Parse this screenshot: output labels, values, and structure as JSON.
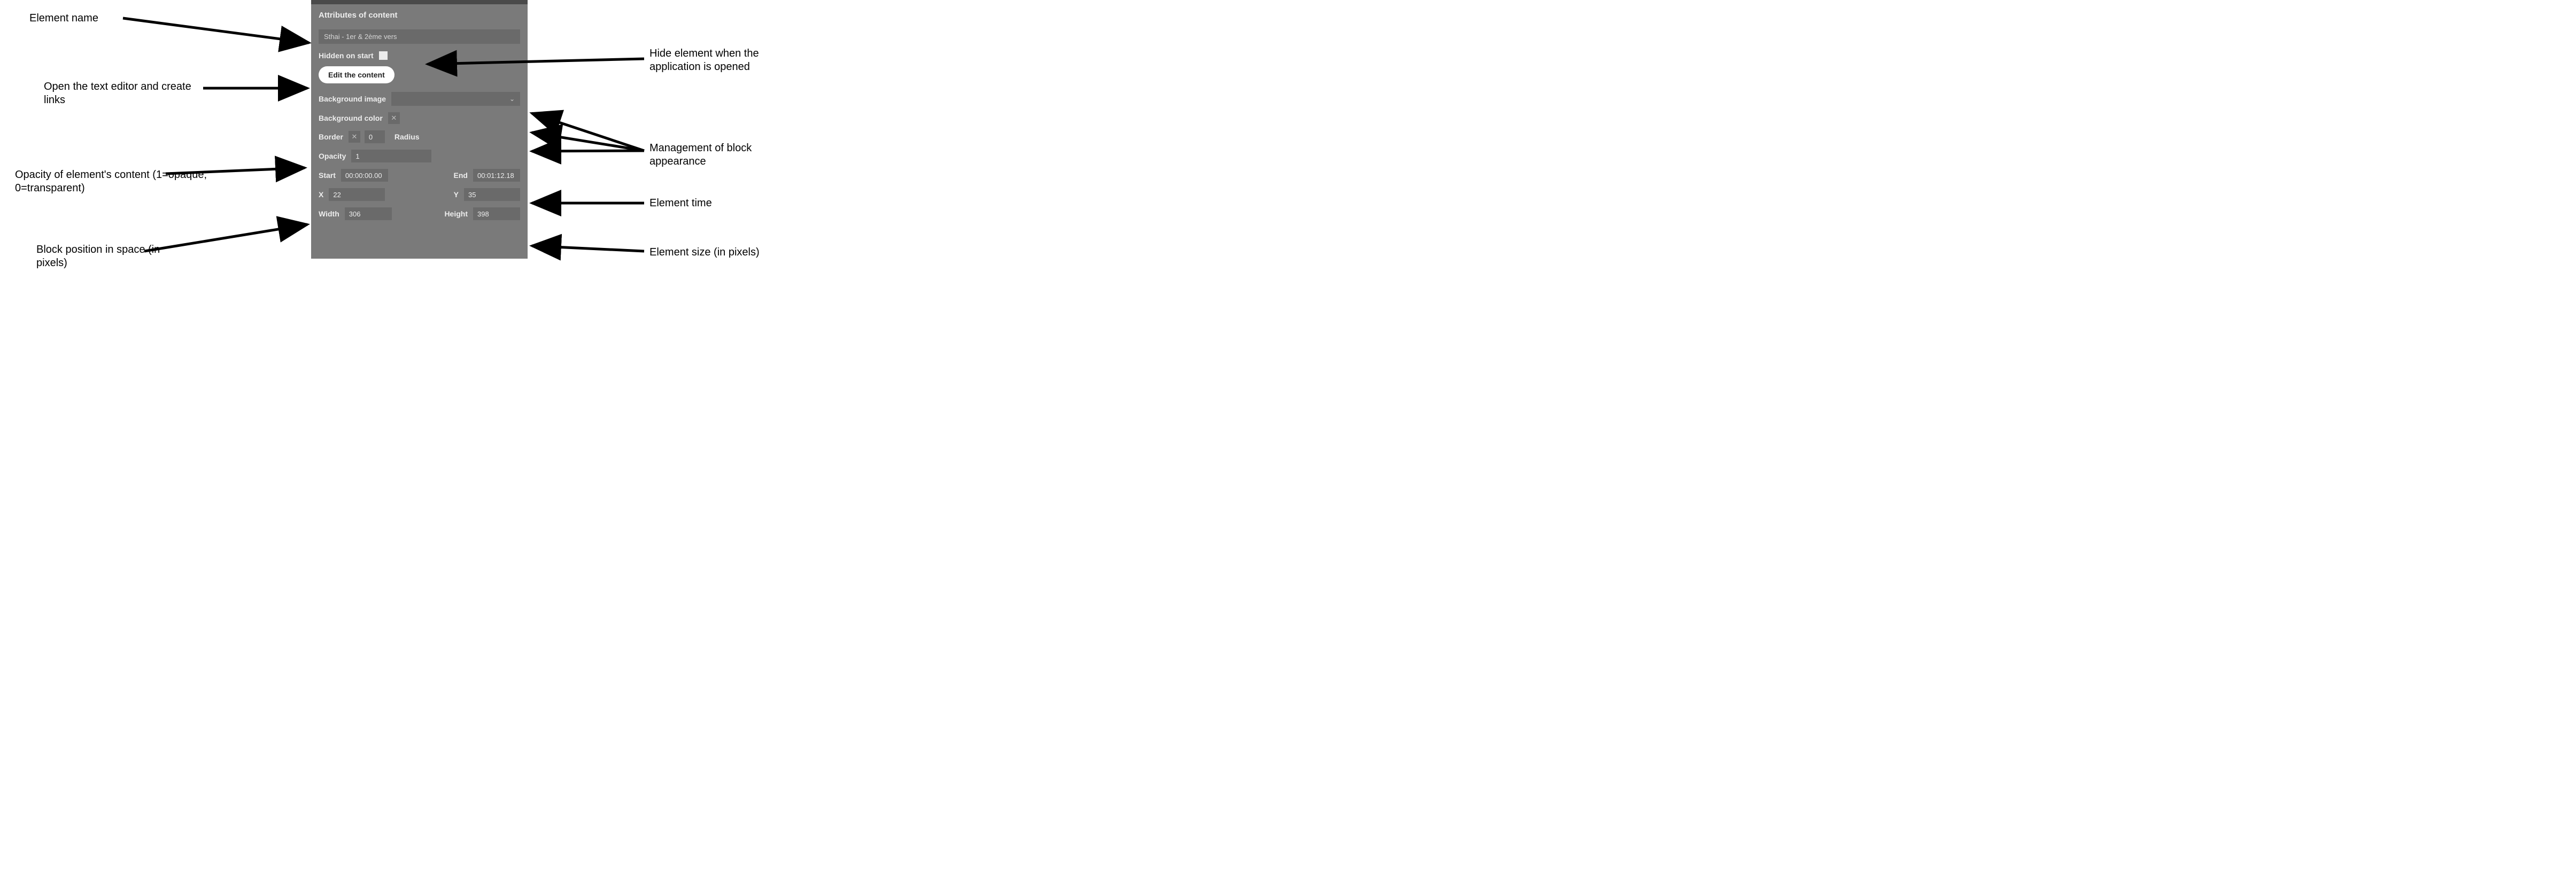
{
  "panel": {
    "title": "Attributes of content",
    "elementName": "Sthai - 1er & 2ème vers",
    "hiddenOnStartLabel": "Hidden on start",
    "editButton": "Edit the content",
    "bgImageLabel": "Background image",
    "bgColorLabel": "Background color",
    "borderLabel": "Border",
    "borderValue": "0",
    "radiusLabel": "Radius",
    "opacityLabel": "Opacity",
    "opacityValue": "1",
    "startLabel": "Start",
    "startValue": "00:00:00.00",
    "endLabel": "End",
    "endValue": "00:01:12.18",
    "xLabel": "X",
    "xValue": "22",
    "yLabel": "Y",
    "yValue": "35",
    "widthLabel": "Width",
    "widthValue": "306",
    "heightLabel": "Height",
    "heightValue": "398"
  },
  "annotations": {
    "elementName": "Element name",
    "openEditor": "Open the text editor and create links",
    "opacity": "Opacity of element's content (1=opaque; 0=transparent)",
    "blockPosition": "Block position in space (in pixels)",
    "hideElement": "Hide element when the application is opened",
    "blockAppearance": "Management of block appearance",
    "elementTime": "Element time",
    "elementSize": "Element size (in pixels)"
  }
}
